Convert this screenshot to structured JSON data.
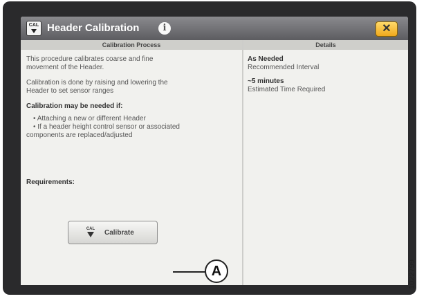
{
  "window": {
    "title": "Header Calibration",
    "icon_label": "CAL",
    "close_label": "✕",
    "info_label": "i"
  },
  "left": {
    "heading": "Calibration Process",
    "intro_line1": "This procedure calibrates coarse and fine",
    "intro_line2": "movement of the Header.",
    "calib_line1": "Calibration is done by raising and lowering the",
    "calib_line2": "Header to set sensor ranges",
    "needed_heading": "Calibration may be needed if:",
    "bullet1": "• Attaching a new or different Header",
    "bullet2_line1": "• If a header height control sensor or associated",
    "bullet2_line2": "components are replaced/adjusted",
    "requirements_heading": "Requirements:"
  },
  "right": {
    "heading": "Details",
    "interval_value": "As Needed",
    "interval_label": "Recommended Interval",
    "time_value": "~5 minutes",
    "time_label": "Estimated Time Required"
  },
  "calibrate_button": {
    "label": "Calibrate",
    "icon_text": "CAL"
  },
  "callout": "A",
  "figure_id": "1022799"
}
